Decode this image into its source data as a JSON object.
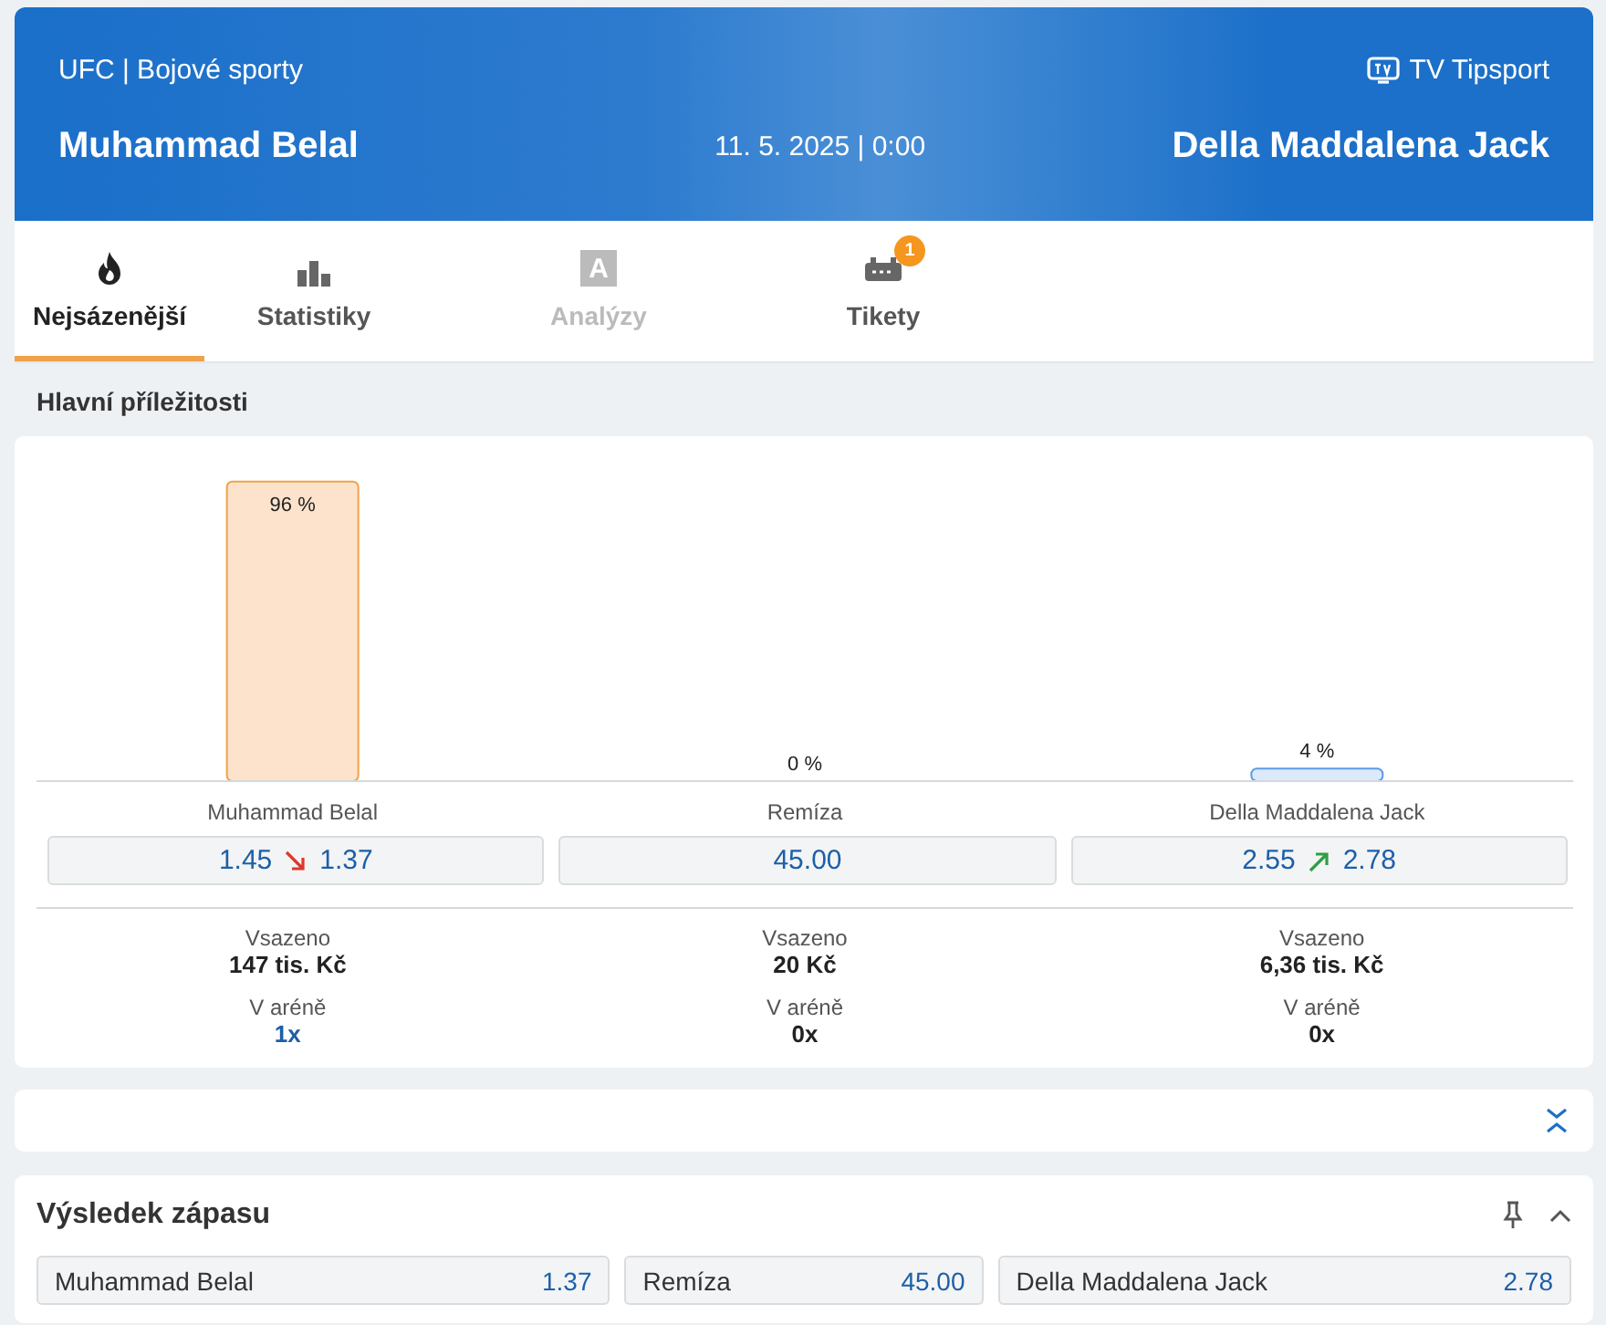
{
  "header": {
    "category": "UFC | Bojové sporty",
    "tv_label": "TV Tipsport",
    "home": "Muhammad Belal",
    "datetime": "11. 5. 2025 | 0:00",
    "away": "Della Maddalena Jack"
  },
  "tabs": [
    {
      "label": "Nejsázenější",
      "kind": "flame",
      "selected": true,
      "disabled": false
    },
    {
      "label": "Statistiky",
      "kind": "bars",
      "selected": false,
      "disabled": false
    },
    {
      "label": "Analýzy",
      "kind": "letter",
      "icon_text": "A",
      "selected": false,
      "disabled": true
    },
    {
      "label": "Tikety",
      "kind": "ticket",
      "badge": "1",
      "selected": false,
      "disabled": false
    }
  ],
  "main": {
    "title": "Hlavní příležitosti",
    "chart_data": {
      "type": "bar",
      "categories": [
        "Muhammad Belal",
        "Remíza",
        "Della Maddalena Jack"
      ],
      "values": [
        96,
        0,
        4
      ],
      "value_labels": [
        "96 %",
        "0 %",
        "4 %"
      ]
    },
    "outcomes": [
      {
        "old_odds": "1.45",
        "kind": "falling",
        "odds": "1.37",
        "staked_label": "Vsazeno",
        "staked": "147 tis. Kč",
        "arena_label": "V aréně",
        "arena": "1x",
        "highlighted": true
      },
      {
        "odds": "45.00",
        "kind": "steady",
        "staked_label": "Vsazeno",
        "staked": "20 Kč",
        "arena_label": "V aréně",
        "arena": "0x",
        "highlighted": false
      },
      {
        "old_odds": "2.55",
        "kind": "rising",
        "odds": "2.78",
        "staked_label": "Vsazeno",
        "staked": "6,36 tis. Kč",
        "arena_label": "V aréně",
        "arena": "0x",
        "highlighted": false
      }
    ]
  },
  "market": {
    "title": "Výsledek zápasu",
    "expanded": true,
    "pinned": false,
    "options": [
      {
        "name": "Muhammad Belal",
        "odds": "1.37"
      },
      {
        "name": "Remíza",
        "odds": "45.00"
      },
      {
        "name": "Della Maddalena Jack",
        "odds": "2.78"
      }
    ]
  }
}
